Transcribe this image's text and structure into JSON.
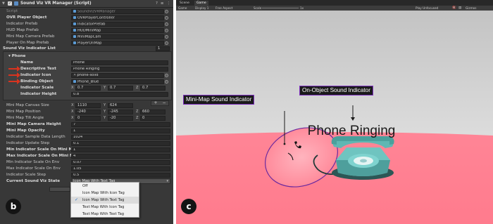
{
  "inspector": {
    "component_title": "Sound Viz VR Manager (Script)",
    "script": {
      "label": "Script",
      "value": "SoundVizVRManager"
    },
    "fields": [
      {
        "label": "OVR Player Object",
        "value": "OVRPlayerController"
      },
      {
        "label": "Indicator Prefab",
        "value": "IndicatorPrefab"
      },
      {
        "label": "HUD Map Prefab",
        "value": "HUDMiniMap"
      },
      {
        "label": "Mini Map Camera Prefab",
        "value": "MiniMapCam"
      },
      {
        "label": "Player On Map Prefab",
        "value": "PlayerOnMap"
      }
    ],
    "list": {
      "label": "Sound Viz Indicator List",
      "count": "1",
      "element": {
        "foldout_label": "Phone",
        "name_label": "Name",
        "name_value": "Phone",
        "desc_label": "Descriptive Text",
        "desc_value": "Phone Ringing",
        "icon_label": "Indicator Icon",
        "icon_value": "phone-solid",
        "binding_label": "Binding Object",
        "binding_value": "Phone_Blue",
        "scale_label": "Indicator Scale",
        "scale": {
          "x": "0.7",
          "y": "0.7",
          "z": "0.7"
        },
        "height_label": "Indicator Height",
        "height_value": "0.8"
      },
      "add": "+",
      "remove": "−"
    },
    "settings": [
      {
        "label": "Mini Map Canvas Size",
        "x": "1110",
        "y": "624"
      },
      {
        "label": "Mini Map Position",
        "x": "-240",
        "y": "-245",
        "z": "660"
      },
      {
        "label": "Mini Map Tilt Angle",
        "x": "0",
        "y": "-20",
        "z": "0"
      },
      {
        "label": "Mini Map Camera Height",
        "value": "7"
      },
      {
        "label": "Mini Map Opacity",
        "value": "1"
      },
      {
        "label": "Indicator Sample Data Length",
        "value": "1024"
      },
      {
        "label": "Indicator Update Step",
        "value": "0.1"
      },
      {
        "label": "Min Indicator Scale On Mini Map",
        "value": "1"
      },
      {
        "label": "Max Indicator Scale On Mini Map",
        "value": "4"
      },
      {
        "label": "Min Indicator Scale On Env",
        "value": "0.07"
      },
      {
        "label": "Max Indicator Scale On Env",
        "value": "1.05"
      },
      {
        "label": "Indicator Scale Step",
        "value": "0.5"
      }
    ],
    "state_label": "Current Sound Viz State",
    "state_value": "Icon Map With Text Tag",
    "dropdown_options": [
      "Off",
      "Icon Map With Icon Tag",
      "Icon Map With Text Tag",
      "Text Map With Icon Tag",
      "Text Map With Text Tag"
    ],
    "selected_option": "Icon Map With Text Tag",
    "panel_badge": "b"
  },
  "game_view": {
    "tabs": [
      "Scene",
      "Game"
    ],
    "toolbar": {
      "mode": "Game",
      "display": "Display 1",
      "aspect": "Free Aspect",
      "scale_label": "Scale",
      "scale_value": "1x",
      "play_mode": "Play Unfocused",
      "gizmos": "Gizmos"
    },
    "minimap_label": "Mini-Map Sound Indicator",
    "onobject_label": "On-Object Sound Indicator",
    "floating_text": "Phone Ringing",
    "panel_badge": "c",
    "colors": {
      "sky_top": "#c3c3c3",
      "sky_horizon": "#ececec",
      "floor": "#ff7f91",
      "minimap_fill": "#ff95a4",
      "callout_border": "#7d2fbf",
      "phone": "#6fc4c0"
    }
  }
}
